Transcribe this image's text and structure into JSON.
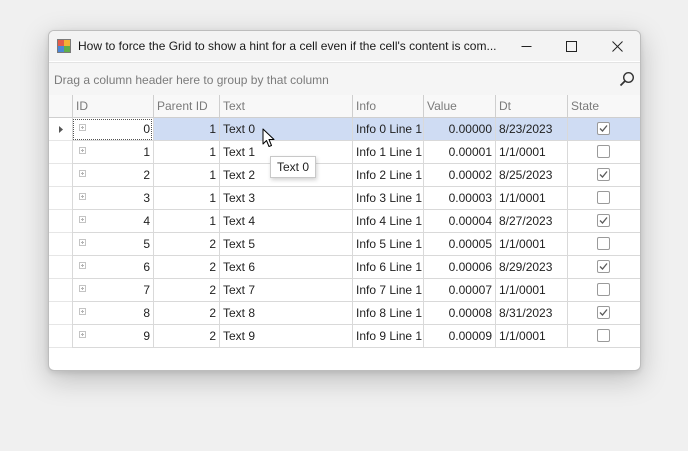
{
  "window": {
    "title": "How to force the Grid to show a hint for a cell even if the cell's content is com...",
    "icon": "grid-app-icon"
  },
  "group_panel": {
    "hint": "Drag a column header here to group by that column",
    "icon": "search-icon"
  },
  "columns": [
    "ID",
    "Parent ID",
    "Text",
    "Info",
    "Value",
    "Dt",
    "State"
  ],
  "rows": [
    {
      "id": "0",
      "parent_id": "1",
      "text": "Text 0",
      "info": "Info 0 Line 1",
      "value": "0.00000",
      "dt": "8/23/2023",
      "state": true
    },
    {
      "id": "1",
      "parent_id": "1",
      "text": "Text 1",
      "info": "Info 1 Line 1",
      "value": "0.00001",
      "dt": "1/1/0001",
      "state": false
    },
    {
      "id": "2",
      "parent_id": "1",
      "text": "Text 2",
      "info": "Info 2 Line 1",
      "value": "0.00002",
      "dt": "8/25/2023",
      "state": true
    },
    {
      "id": "3",
      "parent_id": "1",
      "text": "Text 3",
      "info": "Info 3 Line 1",
      "value": "0.00003",
      "dt": "1/1/0001",
      "state": false
    },
    {
      "id": "4",
      "parent_id": "1",
      "text": "Text 4",
      "info": "Info 4 Line 1",
      "value": "0.00004",
      "dt": "8/27/2023",
      "state": true
    },
    {
      "id": "5",
      "parent_id": "2",
      "text": "Text 5",
      "info": "Info 5 Line 1",
      "value": "0.00005",
      "dt": "1/1/0001",
      "state": false
    },
    {
      "id": "6",
      "parent_id": "2",
      "text": "Text 6",
      "info": "Info 6 Line 1",
      "value": "0.00006",
      "dt": "8/29/2023",
      "state": true
    },
    {
      "id": "7",
      "parent_id": "2",
      "text": "Text 7",
      "info": "Info 7 Line 1",
      "value": "0.00007",
      "dt": "1/1/0001",
      "state": false
    },
    {
      "id": "8",
      "parent_id": "2",
      "text": "Text 8",
      "info": "Info 8 Line 1",
      "value": "0.00008",
      "dt": "8/31/2023",
      "state": true
    },
    {
      "id": "9",
      "parent_id": "2",
      "text": "Text 9",
      "info": "Info 9 Line 1",
      "value": "0.00009",
      "dt": "1/1/0001",
      "state": false
    }
  ],
  "focused_row": 0,
  "tooltip": {
    "text": "Text 0"
  },
  "colors": {
    "focused_row": "#cfdcf3",
    "grid_line": "#d9d9d9",
    "header_text": "#7a7a7a",
    "group_hint": "#7b7b7b"
  }
}
